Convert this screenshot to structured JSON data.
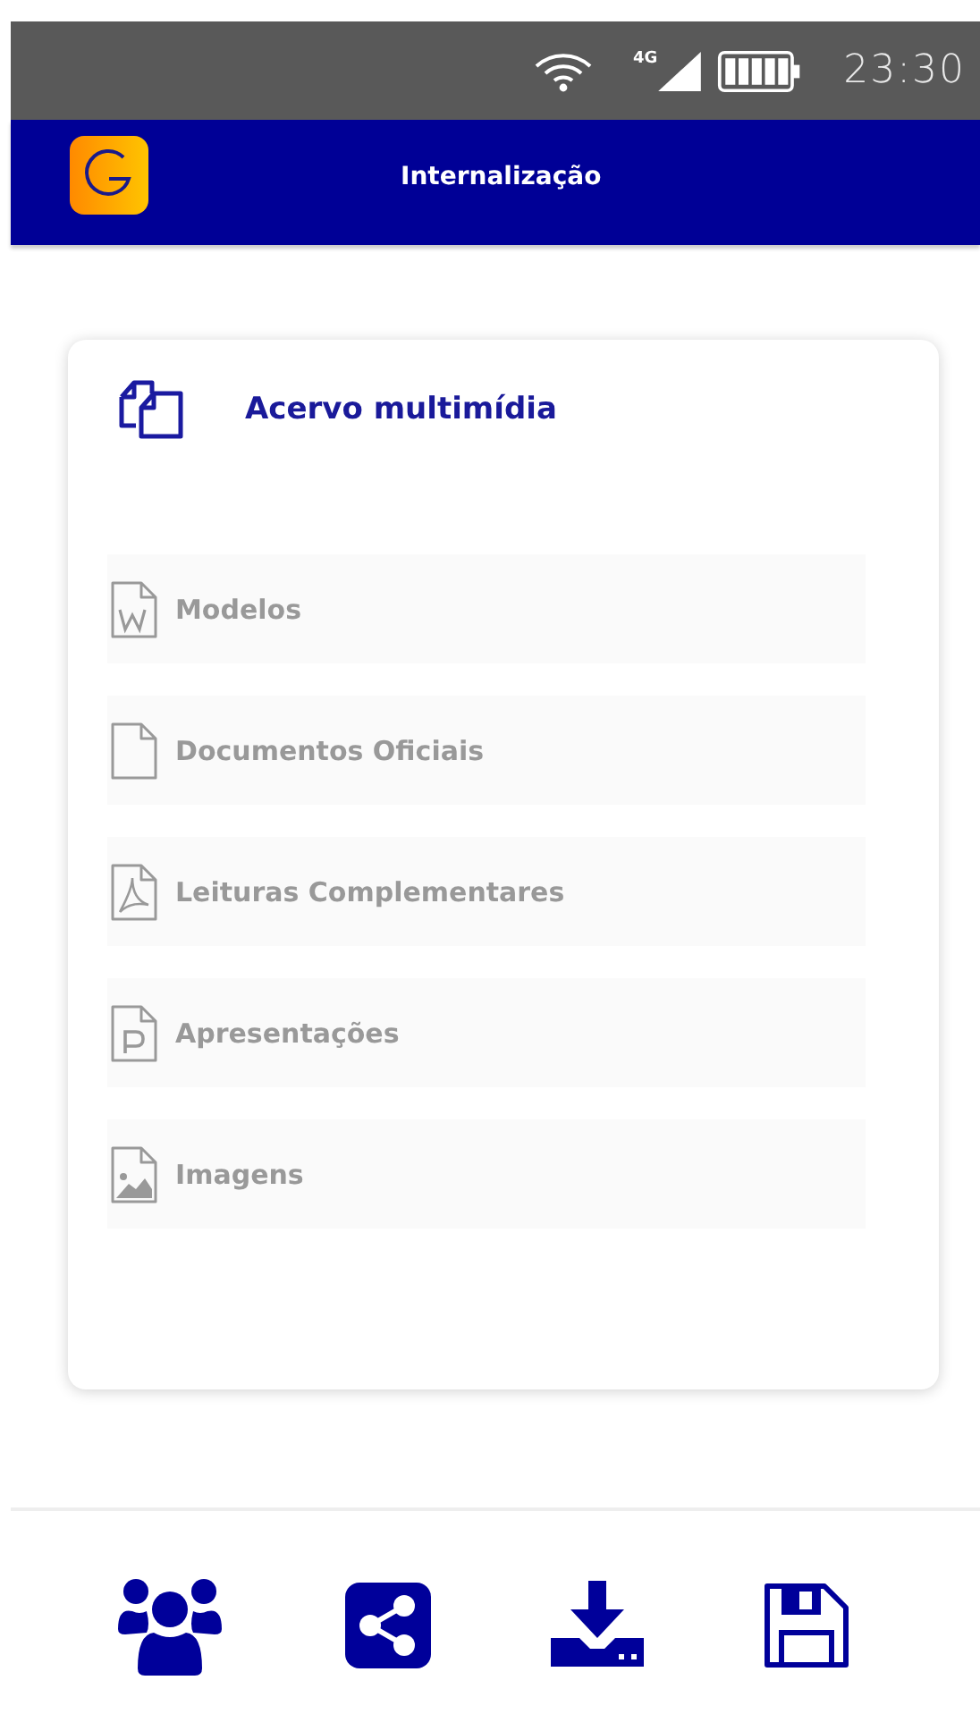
{
  "status_bar": {
    "time": "23:30",
    "network": "4G"
  },
  "header": {
    "title": "Internalização"
  },
  "card": {
    "title": "Acervo multimídia",
    "items": [
      {
        "label": "Modelos",
        "kind": "word"
      },
      {
        "label": "Documentos Oficiais",
        "kind": "blank"
      },
      {
        "label": "Leituras Complementares",
        "kind": "pdf"
      },
      {
        "label": "Apresentações",
        "kind": "slides"
      },
      {
        "label": "Imagens",
        "kind": "image"
      }
    ]
  },
  "toolbar": [
    {
      "kind": "users"
    },
    {
      "kind": "share"
    },
    {
      "kind": "download"
    },
    {
      "kind": "save"
    }
  ]
}
